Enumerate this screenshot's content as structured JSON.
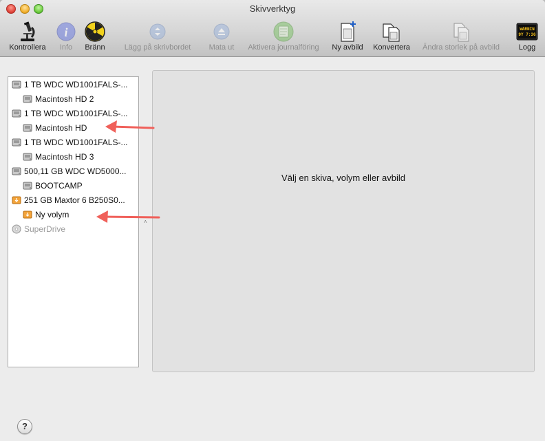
{
  "window": {
    "title": "Skivverktyg"
  },
  "toolbar": {
    "items": [
      {
        "label": "Kontrollera"
      },
      {
        "label": "Info"
      },
      {
        "label": "Bränn"
      },
      {
        "label": "Lägg på skrivbordet"
      },
      {
        "label": "Mata ut"
      },
      {
        "label": "Aktivera journalföring"
      },
      {
        "label": "Ny avbild"
      },
      {
        "label": "Konvertera"
      },
      {
        "label": "Ändra storlek på avbild"
      },
      {
        "label": "Logg"
      }
    ],
    "log_icon_text": {
      "line1": "WARNIN",
      "line2": "9Y 7:36"
    }
  },
  "sidebar": {
    "items": [
      {
        "label": "1 TB WDC WD1001FALS-..."
      },
      {
        "label": "Macintosh HD 2"
      },
      {
        "label": "1 TB WDC WD1001FALS-..."
      },
      {
        "label": "Macintosh HD"
      },
      {
        "label": "1 TB WDC WD1001FALS-..."
      },
      {
        "label": "Macintosh HD 3"
      },
      {
        "label": "500,11 GB WDC WD5000..."
      },
      {
        "label": "BOOTCAMP"
      },
      {
        "label": "251 GB Maxtor 6 B250S0..."
      },
      {
        "label": "Ny volym"
      },
      {
        "label": "SuperDrive"
      }
    ]
  },
  "main": {
    "placeholder": "Välj en skiva, volym eller avbild"
  },
  "help": {
    "label": "?"
  },
  "colors": {
    "annotation_arrow": "#f0605a",
    "external_disk": "#f2a33a"
  }
}
